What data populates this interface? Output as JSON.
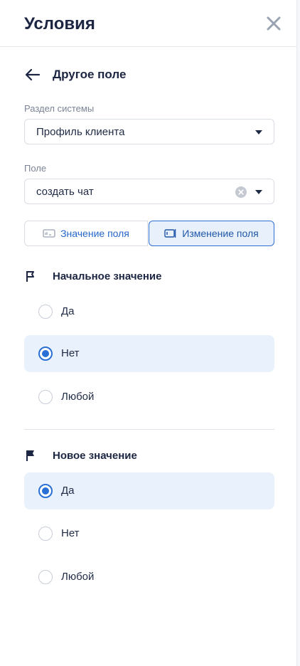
{
  "header": {
    "title": "Условия",
    "close_icon": "close-icon"
  },
  "subheader": {
    "back_icon": "arrow-left-icon",
    "title": "Другое поле"
  },
  "section_field": {
    "label": "Раздел системы",
    "value": "Профиль клиента"
  },
  "field": {
    "label": "Поле",
    "value": "создать чат"
  },
  "tabs": {
    "left": {
      "label": "Значение поля",
      "icon": "text-field-icon",
      "selected": false
    },
    "right": {
      "label": "Изменение поля",
      "icon": "field-edit-icon",
      "selected": true
    }
  },
  "initial": {
    "title": "Начальное значение",
    "icon": "flag-outline-icon",
    "options": [
      {
        "label": "Да",
        "selected": false
      },
      {
        "label": "Нет",
        "selected": true
      },
      {
        "label": "Любой",
        "selected": false
      }
    ]
  },
  "new_value": {
    "title": "Новое значение",
    "icon": "flag-filled-icon",
    "options": [
      {
        "label": "Да",
        "selected": true
      },
      {
        "label": "Нет",
        "selected": false
      },
      {
        "label": "Любой",
        "selected": false
      }
    ]
  },
  "colors": {
    "accent": "#2a6fd6",
    "selected_bg": "#e9f1fc",
    "text": "#1c2541",
    "muted": "#7b8496"
  }
}
